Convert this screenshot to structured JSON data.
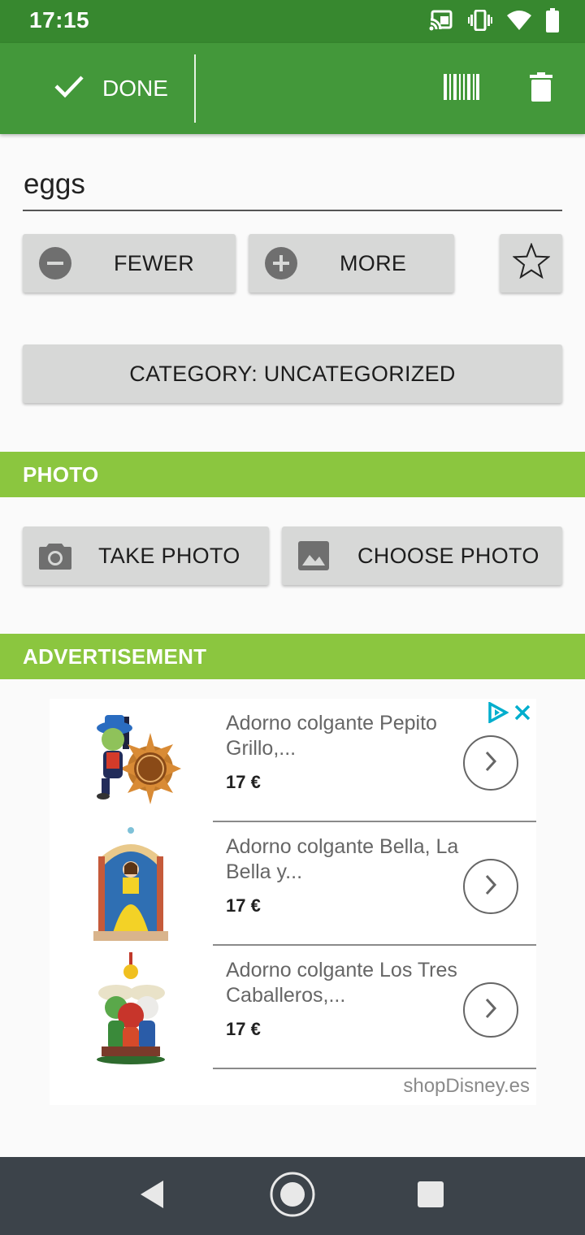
{
  "status_bar": {
    "time": "17:15",
    "icons": [
      "cast-icon",
      "vibrate-icon",
      "wifi-icon",
      "battery-icon"
    ]
  },
  "toolbar": {
    "done_label": "DONE",
    "icons": [
      "check-icon",
      "barcode-icon",
      "trash-icon"
    ]
  },
  "item": {
    "name": "eggs"
  },
  "quantity": {
    "fewer_label": "FEWER",
    "more_label": "MORE"
  },
  "category": {
    "label": "CATEGORY: UNCATEGORIZED"
  },
  "photo": {
    "section_title": "PHOTO",
    "take_label": "TAKE PHOTO",
    "choose_label": "CHOOSE PHOTO"
  },
  "advertisement": {
    "section_title": "ADVERTISEMENT",
    "source": "shopDisney.es",
    "items": [
      {
        "title": "Adorno colgante Pepito Grillo,...",
        "price": "17 €"
      },
      {
        "title": "Adorno colgante Bella, La Bella y...",
        "price": "17 €"
      },
      {
        "title": "Adorno colgante Los Tres Caballeros,...",
        "price": "17 €"
      }
    ]
  },
  "colors": {
    "status_bar": "#37882f",
    "toolbar": "#43983a",
    "section_header": "#8bc63f",
    "button_bg": "#d7d8d7",
    "nav_bar": "#3c434a",
    "ad_badge": "#00aecd"
  }
}
